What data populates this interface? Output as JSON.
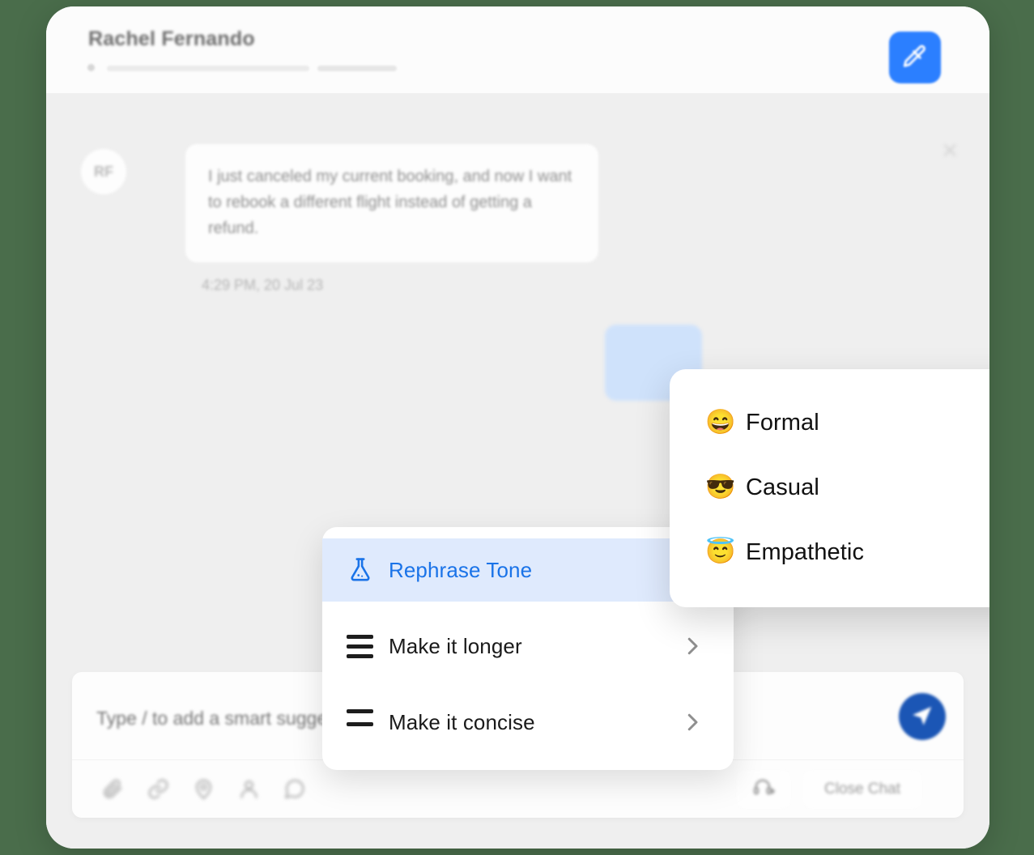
{
  "header": {
    "contact_name": "Rachel Fernando",
    "edit_icon": "pen-edit-icon"
  },
  "conversation": {
    "close_icon": "close-icon",
    "message": {
      "avatar_initials": "RF",
      "text": "I just canceled my current booking, and now I want to rebook a different flight instead of getting a refund.",
      "timestamp": "4:29 PM,  20 Jul 23"
    }
  },
  "smart_menu": {
    "items": [
      {
        "label": "Rephrase Tone",
        "icon": "flask-icon",
        "active": true,
        "has_submenu": true
      },
      {
        "label": "Make it longer",
        "icon": "three-lines-icon",
        "active": false,
        "has_submenu": true
      },
      {
        "label": "Make it concise",
        "icon": "two-lines-icon",
        "active": false,
        "has_submenu": true
      }
    ]
  },
  "tone_menu": {
    "items": [
      {
        "label": "Formal",
        "emoji": "😄"
      },
      {
        "label": "Casual",
        "emoji": "😎"
      },
      {
        "label": "Empathetic",
        "emoji": "😇"
      }
    ]
  },
  "composer": {
    "placeholder": "Type / to add a smart suggestion",
    "value": "",
    "send_icon": "send-paper-plane-icon",
    "tools": [
      {
        "name": "attachment-icon"
      },
      {
        "name": "link-icon"
      },
      {
        "name": "location-pin-icon"
      },
      {
        "name": "person-icon"
      },
      {
        "name": "chat-bubble-icon"
      }
    ],
    "headset_label": "headset-add-icon",
    "close_chat_label": "Close Chat"
  },
  "colors": {
    "page_background": "#4a6d4b",
    "accent_blue": "#2b7fff",
    "menu_highlight": "#dfeafd",
    "menu_highlight_text": "#1a73e8",
    "send_button": "#1b56b5"
  }
}
